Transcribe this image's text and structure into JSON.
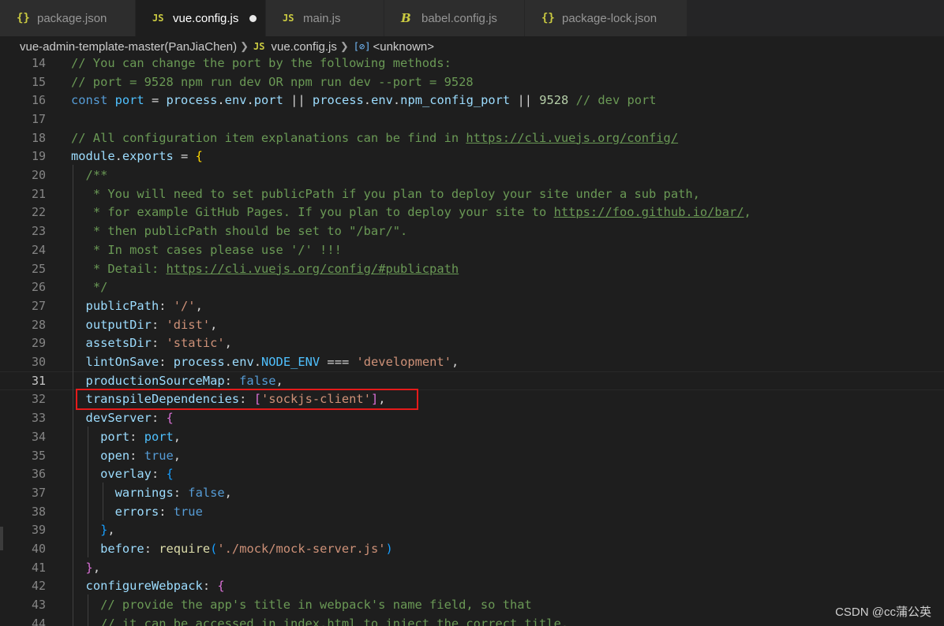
{
  "tabs": [
    {
      "label": "package.json",
      "icon": "json-curly-icon",
      "glyph": "{}",
      "active": false
    },
    {
      "label": "vue.config.js",
      "icon": "js-file-icon",
      "glyph": "JS",
      "active": true,
      "modified": true
    },
    {
      "label": "main.js",
      "icon": "js-file-icon",
      "glyph": "JS",
      "active": false
    },
    {
      "label": "babel.config.js",
      "icon": "babel-icon",
      "glyph": "B",
      "active": false
    },
    {
      "label": "package-lock.json",
      "icon": "json-curly-icon",
      "glyph": "{}",
      "active": false
    }
  ],
  "breadcrumb": {
    "folder": "vue-admin-template-master(PanJiaChen)",
    "file_icon": "JS",
    "file": "vue.config.js",
    "symbol_icon": "[⊘]",
    "symbol": "<unknown>"
  },
  "editor": {
    "current_line": 31,
    "lines": [
      {
        "n": "14",
        "tokens": [
          [
            "com",
            "// You can change the port by the following methods:"
          ]
        ]
      },
      {
        "n": "15",
        "tokens": [
          [
            "com",
            "// port = 9528 npm run dev OR npm run dev --port = 9528"
          ]
        ]
      },
      {
        "n": "16",
        "tokens": [
          [
            "kw",
            "const"
          ],
          [
            "txt",
            " "
          ],
          [
            "cst",
            "port"
          ],
          [
            "txt",
            " = "
          ],
          [
            "var",
            "process"
          ],
          [
            "txt",
            "."
          ],
          [
            "var",
            "env"
          ],
          [
            "txt",
            "."
          ],
          [
            "var",
            "port"
          ],
          [
            "txt",
            " || "
          ],
          [
            "var",
            "process"
          ],
          [
            "txt",
            "."
          ],
          [
            "var",
            "env"
          ],
          [
            "txt",
            "."
          ],
          [
            "var",
            "npm_config_port"
          ],
          [
            "txt",
            " || "
          ],
          [
            "num",
            "9528"
          ],
          [
            "txt",
            " "
          ],
          [
            "com",
            "// dev port"
          ]
        ]
      },
      {
        "n": "17",
        "tokens": []
      },
      {
        "n": "18",
        "tokens": [
          [
            "com",
            "// All configuration item explanations can be find in "
          ],
          [
            "link",
            "https://cli.vuejs.org/config/"
          ]
        ]
      },
      {
        "n": "19",
        "tokens": [
          [
            "var",
            "module"
          ],
          [
            "txt",
            "."
          ],
          [
            "var",
            "exports"
          ],
          [
            "txt",
            " = "
          ],
          [
            "b1",
            "{"
          ]
        ]
      },
      {
        "n": "20",
        "tokens": [
          [
            "txt",
            "  "
          ],
          [
            "com",
            "/**"
          ]
        ]
      },
      {
        "n": "21",
        "tokens": [
          [
            "txt",
            "  "
          ],
          [
            "com",
            " * You will need to set publicPath if you plan to deploy your site under a sub path,"
          ]
        ]
      },
      {
        "n": "22",
        "tokens": [
          [
            "txt",
            "  "
          ],
          [
            "com",
            " * for example GitHub Pages. If you plan to deploy your site to "
          ],
          [
            "link",
            "https://foo.github.io/bar/"
          ],
          [
            "com",
            ","
          ]
        ]
      },
      {
        "n": "23",
        "tokens": [
          [
            "txt",
            "  "
          ],
          [
            "com",
            " * then publicPath should be set to \"/bar/\"."
          ]
        ]
      },
      {
        "n": "24",
        "tokens": [
          [
            "txt",
            "  "
          ],
          [
            "com",
            " * In most cases please use '/' !!!"
          ]
        ]
      },
      {
        "n": "25",
        "tokens": [
          [
            "txt",
            "  "
          ],
          [
            "com",
            " * Detail: "
          ],
          [
            "link",
            "https://cli.vuejs.org/config/#publicpath"
          ]
        ]
      },
      {
        "n": "26",
        "tokens": [
          [
            "txt",
            "  "
          ],
          [
            "com",
            " */"
          ]
        ]
      },
      {
        "n": "27",
        "tokens": [
          [
            "txt",
            "  "
          ],
          [
            "var",
            "publicPath"
          ],
          [
            "txt",
            ": "
          ],
          [
            "str",
            "'/'"
          ],
          [
            "txt",
            ","
          ]
        ]
      },
      {
        "n": "28",
        "tokens": [
          [
            "txt",
            "  "
          ],
          [
            "var",
            "outputDir"
          ],
          [
            "txt",
            ": "
          ],
          [
            "str",
            "'dist'"
          ],
          [
            "txt",
            ","
          ]
        ]
      },
      {
        "n": "29",
        "tokens": [
          [
            "txt",
            "  "
          ],
          [
            "var",
            "assetsDir"
          ],
          [
            "txt",
            ": "
          ],
          [
            "str",
            "'static'"
          ],
          [
            "txt",
            ","
          ]
        ]
      },
      {
        "n": "30",
        "tokens": [
          [
            "txt",
            "  "
          ],
          [
            "var",
            "lintOnSave"
          ],
          [
            "txt",
            ": "
          ],
          [
            "var",
            "process"
          ],
          [
            "txt",
            "."
          ],
          [
            "var",
            "env"
          ],
          [
            "txt",
            "."
          ],
          [
            "cst",
            "NODE_ENV"
          ],
          [
            "txt",
            " === "
          ],
          [
            "str",
            "'development'"
          ],
          [
            "txt",
            ","
          ]
        ]
      },
      {
        "n": "31",
        "tokens": [
          [
            "txt",
            "  "
          ],
          [
            "var",
            "productionSourceMap"
          ],
          [
            "txt",
            ": "
          ],
          [
            "kw",
            "false"
          ],
          [
            "txt",
            ","
          ]
        ]
      },
      {
        "n": "32",
        "tokens": [
          [
            "txt",
            "  "
          ],
          [
            "var",
            "transpileDependencies"
          ],
          [
            "txt",
            ": "
          ],
          [
            "b2",
            "["
          ],
          [
            "str",
            "'sockjs-client'"
          ],
          [
            "b2",
            "]"
          ],
          [
            "txt",
            ","
          ]
        ]
      },
      {
        "n": "33",
        "tokens": [
          [
            "txt",
            "  "
          ],
          [
            "var",
            "devServer"
          ],
          [
            "txt",
            ": "
          ],
          [
            "b2",
            "{"
          ]
        ]
      },
      {
        "n": "34",
        "tokens": [
          [
            "txt",
            "    "
          ],
          [
            "var",
            "port"
          ],
          [
            "txt",
            ": "
          ],
          [
            "cst",
            "port"
          ],
          [
            "txt",
            ","
          ]
        ]
      },
      {
        "n": "35",
        "tokens": [
          [
            "txt",
            "    "
          ],
          [
            "var",
            "open"
          ],
          [
            "txt",
            ": "
          ],
          [
            "kw",
            "true"
          ],
          [
            "txt",
            ","
          ]
        ]
      },
      {
        "n": "36",
        "tokens": [
          [
            "txt",
            "    "
          ],
          [
            "var",
            "overlay"
          ],
          [
            "txt",
            ": "
          ],
          [
            "b3",
            "{"
          ]
        ]
      },
      {
        "n": "37",
        "tokens": [
          [
            "txt",
            "      "
          ],
          [
            "var",
            "warnings"
          ],
          [
            "txt",
            ": "
          ],
          [
            "kw",
            "false"
          ],
          [
            "txt",
            ","
          ]
        ]
      },
      {
        "n": "38",
        "tokens": [
          [
            "txt",
            "      "
          ],
          [
            "var",
            "errors"
          ],
          [
            "txt",
            ": "
          ],
          [
            "kw",
            "true"
          ]
        ]
      },
      {
        "n": "39",
        "tokens": [
          [
            "txt",
            "    "
          ],
          [
            "b3",
            "}"
          ],
          [
            "txt",
            ","
          ]
        ]
      },
      {
        "n": "40",
        "tokens": [
          [
            "txt",
            "    "
          ],
          [
            "var",
            "before"
          ],
          [
            "txt",
            ": "
          ],
          [
            "fn",
            "require"
          ],
          [
            "b3",
            "("
          ],
          [
            "str",
            "'./mock/mock-server.js'"
          ],
          [
            "b3",
            ")"
          ]
        ]
      },
      {
        "n": "41",
        "tokens": [
          [
            "txt",
            "  "
          ],
          [
            "b2",
            "}"
          ],
          [
            "txt",
            ","
          ]
        ]
      },
      {
        "n": "42",
        "tokens": [
          [
            "txt",
            "  "
          ],
          [
            "var",
            "configureWebpack"
          ],
          [
            "txt",
            ": "
          ],
          [
            "b2",
            "{"
          ]
        ]
      },
      {
        "n": "43",
        "tokens": [
          [
            "txt",
            "    "
          ],
          [
            "com",
            "// provide the app's title in webpack's name field, so that"
          ]
        ]
      },
      {
        "n": "44",
        "tokens": [
          [
            "txt",
            "    "
          ],
          [
            "com",
            "// it can be accessed in index.html to inject the correct title."
          ]
        ]
      }
    ]
  },
  "watermark": "CSDN @cc蒲公英"
}
